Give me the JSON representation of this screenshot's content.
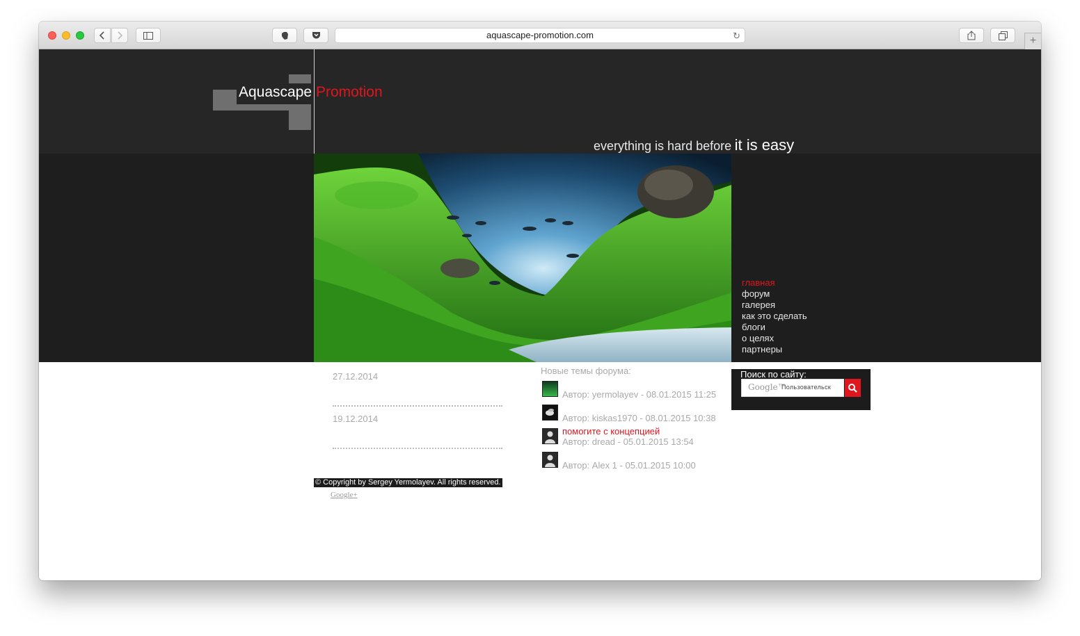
{
  "browser": {
    "url": "aquascape-promotion.com",
    "reload_icon": "reload-icon",
    "new_tab_label": "+"
  },
  "site": {
    "logo_white": "Aquascape",
    "logo_red": "Promotion",
    "slogan_small": "everything is hard before",
    "slogan_big": "it is easy",
    "accent_color": "#e0161e"
  },
  "nav": {
    "items": [
      {
        "label": "главная",
        "active": true
      },
      {
        "label": "форум"
      },
      {
        "label": "галерея"
      },
      {
        "label": "как это сделать"
      },
      {
        "label": "блоги"
      },
      {
        "label": "о целях"
      },
      {
        "label": "партнеры"
      }
    ]
  },
  "news": {
    "dates": [
      "27.12.2014",
      "19.12.2014"
    ]
  },
  "forum": {
    "heading": "Новые темы форума:",
    "topics": [
      {
        "title": "",
        "meta": "Автор: yermolayev - 08.01.2015 11:25",
        "avatar": "aquarium-avatar"
      },
      {
        "title": "",
        "meta": "Автор: kiskas1970 - 08.01.2015 10:38",
        "avatar": "shrimp-avatar"
      },
      {
        "title": "помогите с концепцией",
        "meta": "Автор: dread - 05.01.2015 13:54",
        "avatar": "default-user-avatar"
      },
      {
        "title": "",
        "meta": "Автор: Alex 1 - 05.01.2015 10:00",
        "avatar": "default-user-avatar"
      }
    ]
  },
  "search": {
    "label": "Поиск по сайту:",
    "google_text": "Google™",
    "placeholder": "Пользовательск"
  },
  "footer": {
    "copyright": "© Copyright by Sergey Yermolayev. All rights reserved.",
    "gplus": "Google+"
  }
}
